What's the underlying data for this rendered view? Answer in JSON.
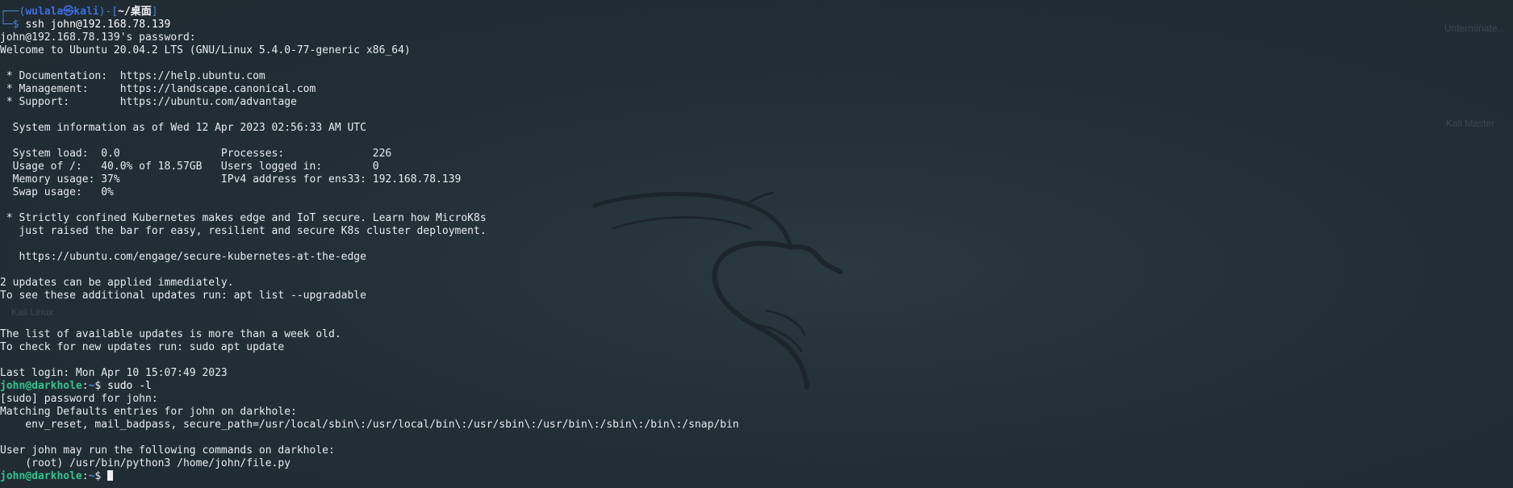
{
  "desktop_ghost": {
    "left_top": "Kali Linux",
    "right_top": "Unterminate...",
    "right_mid": "Kali Master"
  },
  "prompt1": {
    "frame_open": "┌──(",
    "user": "wulala",
    "at": "㉿",
    "host": "kali",
    "mid": ")-[",
    "path": "~/桌面",
    "frame_close": "]",
    "frame_prompt": "└─$ ",
    "command": "ssh john@192.168.78.139"
  },
  "output": [
    "john@192.168.78.139's password: ",
    "Welcome to Ubuntu 20.04.2 LTS (GNU/Linux 5.4.0-77-generic x86_64)",
    "",
    " * Documentation:  https://help.ubuntu.com",
    " * Management:     https://landscape.canonical.com",
    " * Support:        https://ubuntu.com/advantage",
    "",
    "  System information as of Wed 12 Apr 2023 02:56:33 AM UTC",
    "",
    "  System load:  0.0                Processes:              226",
    "  Usage of /:   40.0% of 18.57GB   Users logged in:        0",
    "  Memory usage: 37%                IPv4 address for ens33: 192.168.78.139",
    "  Swap usage:   0%",
    "",
    " * Strictly confined Kubernetes makes edge and IoT secure. Learn how MicroK8s",
    "   just raised the bar for easy, resilient and secure K8s cluster deployment.",
    "",
    "   https://ubuntu.com/engage/secure-kubernetes-at-the-edge",
    "",
    "2 updates can be applied immediately.",
    "To see these additional updates run: apt list --upgradable",
    "",
    "",
    "The list of available updates is more than a week old.",
    "To check for new updates run: sudo apt update",
    "",
    "Last login: Mon Apr 10 15:07:49 2023"
  ],
  "prompt2": {
    "user": "john@darkhole",
    "sep": ":",
    "path": "~",
    "symbol": "$ ",
    "command": "sudo -l"
  },
  "output2": [
    "[sudo] password for john: ",
    "Matching Defaults entries for john on darkhole:",
    "    env_reset, mail_badpass, secure_path=/usr/local/sbin\\:/usr/local/bin\\:/usr/sbin\\:/usr/bin\\:/sbin\\:/bin\\:/snap/bin",
    "",
    "User john may run the following commands on darkhole:",
    "    (root) /usr/bin/python3 /home/john/file.py"
  ],
  "prompt3": {
    "user": "john@darkhole",
    "sep": ":",
    "path": "~",
    "symbol": "$ "
  }
}
